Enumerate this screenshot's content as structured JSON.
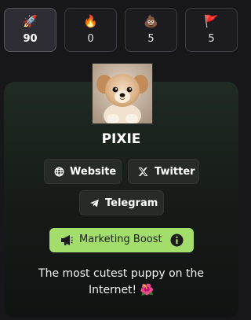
{
  "reactions": [
    {
      "name": "rocket",
      "emoji": "🚀",
      "count": "90",
      "active": true
    },
    {
      "name": "fire",
      "emoji": "🔥",
      "count": "0",
      "active": false
    },
    {
      "name": "poop",
      "emoji": "💩",
      "count": "5",
      "active": false
    },
    {
      "name": "flag",
      "emoji": "🚩",
      "count": "5",
      "active": false
    }
  ],
  "token": {
    "name": "PIXIE",
    "description": "The most cutest puppy on the Internet! 🌺"
  },
  "links": {
    "website_label": "Website",
    "twitter_label": "Twitter",
    "telegram_label": "Telegram"
  },
  "boost": {
    "label": "Marketing Boost"
  },
  "icons": {
    "website": "globe-icon",
    "twitter": "x-logo-icon",
    "telegram": "paper-plane-icon",
    "boost": "megaphone-icon",
    "info": "info-icon"
  },
  "colors": {
    "boost_bg": "#a3de6c",
    "card_top": "#1f2b23",
    "page_bg": "#17171a"
  }
}
